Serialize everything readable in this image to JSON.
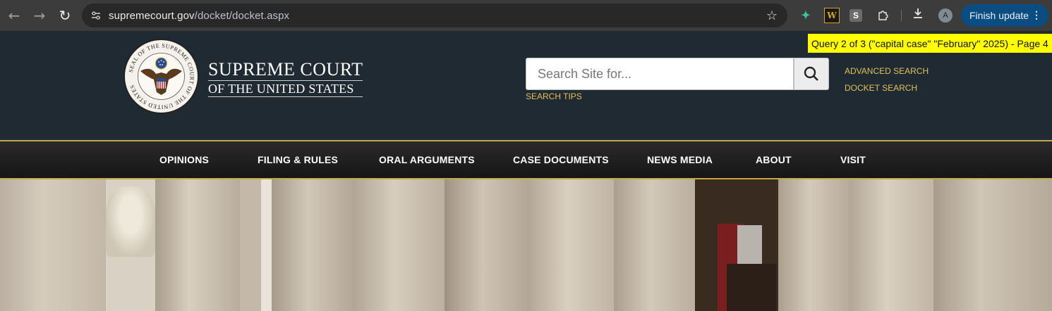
{
  "browser": {
    "url_host": "supremecourt.gov",
    "url_path": "/docket/docket.aspx",
    "update_button": "Finish update",
    "avatar_letter": "A",
    "ext_w": "W",
    "ext_s": "S"
  },
  "find_banner": "Query 2 of 3 (\"capital case\" \"February\" 2025) - Page 4",
  "brand": {
    "line1": "SUPREME COURT",
    "line2": "OF THE UNITED STATES"
  },
  "seal": {
    "ring_text": "SEAL OF THE SUPREME COURT OF THE UNITED STATES"
  },
  "search": {
    "placeholder": "Search Site for...",
    "tips": "SEARCH TIPS",
    "advanced": "ADVANCED SEARCH",
    "docket": "DOCKET SEARCH"
  },
  "nav": [
    "OPINIONS",
    "FILING & RULES",
    "ORAL ARGUMENTS",
    "CASE DOCUMENTS",
    "NEWS MEDIA",
    "ABOUT",
    "VISIT"
  ],
  "colors": {
    "header_bg": "#1f2a33",
    "gold_accent": "#c9a64a",
    "link_gold": "#e0c15a",
    "highlight": "#ffff00"
  }
}
